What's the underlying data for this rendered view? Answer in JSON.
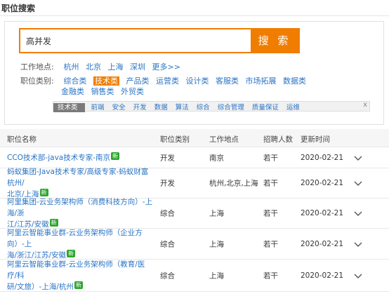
{
  "header": {
    "title": "职位搜索"
  },
  "search": {
    "value": "高并发",
    "button_label": "搜 索"
  },
  "filters": {
    "location_label": "工作地点:",
    "locations": [
      "杭州",
      "北京",
      "上海",
      "深圳",
      "更多>>"
    ],
    "category_label": "职位类别:",
    "categories_row1": [
      "综合类",
      "技术类",
      "产品类",
      "运营类",
      "设计类",
      "客服类",
      "市场拓展",
      "数据类"
    ],
    "categories_row2": [
      "金融类",
      "销售类",
      "外贸类"
    ],
    "active_category": "技术类"
  },
  "subcategories": {
    "label": "技术类",
    "items": [
      "前端",
      "安全",
      "开发",
      "数据",
      "算法",
      "综合",
      "综合管理",
      "质量保证",
      "运维"
    ],
    "close": "x"
  },
  "table": {
    "headers": [
      "职位名称",
      "职位类别",
      "工作地点",
      "招聘人数",
      "更新时间"
    ],
    "new_badge": "新",
    "rows": [
      {
        "title_lines": [
          "CCO技术部-java技术专家-南京"
        ],
        "category": "开发",
        "location": "南京",
        "count": "若干",
        "date": "2020-02-21"
      },
      {
        "title_lines": [
          "蚂蚁集团-Java技术专家/高级专家-蚂蚁财富 杭州/",
          "北京/上海"
        ],
        "category": "开发",
        "location": "杭州,北京,上海",
        "count": "若干",
        "date": "2020-02-21"
      },
      {
        "title_lines": [
          "阿里集团-云业务架构师（消费科技方向）-上海/浙",
          "江/江苏/安徽"
        ],
        "category": "综合",
        "location": "上海",
        "count": "若干",
        "date": "2020-02-21"
      },
      {
        "title_lines": [
          "阿里云智能事业群-云业务架构师（企业方向）-上",
          "海/浙江/江苏/安徽"
        ],
        "category": "综合",
        "location": "上海",
        "count": "若干",
        "date": "2020-02-21"
      },
      {
        "title_lines": [
          "阿里云智能事业群-云业务架构师（教育/医疗/科",
          "研/文旅）-上海/杭州"
        ],
        "category": "综合",
        "location": "上海",
        "count": "若干",
        "date": "2020-02-21"
      }
    ]
  },
  "colors": {
    "accent": "#f07d00",
    "link": "#2a74c5",
    "new_badge": "#2ea52e"
  },
  "icons": {
    "row_expand": "chevron-down-icon"
  }
}
